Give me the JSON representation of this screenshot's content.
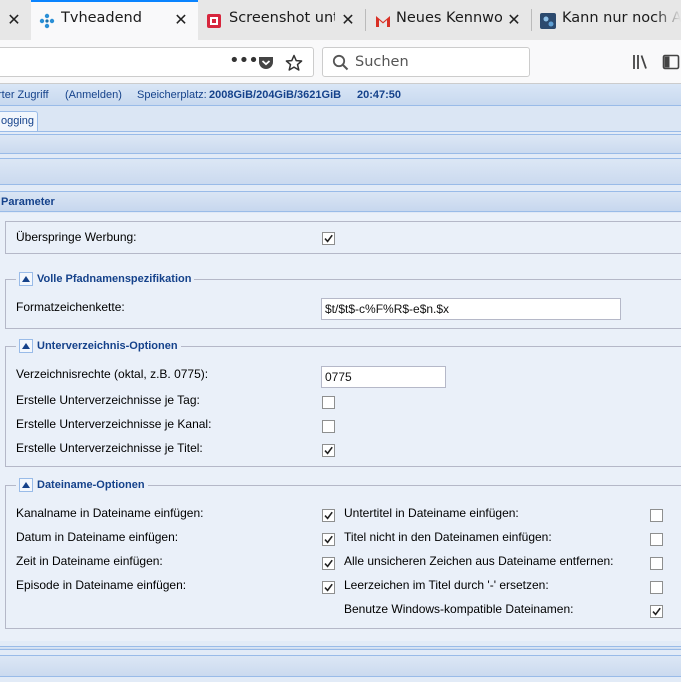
{
  "browser": {
    "tabs": [
      {
        "title": "Tvheadend",
        "favicon": "tvheadend-icon"
      },
      {
        "title": "Screenshot unter",
        "favicon": "screenshot-icon"
      },
      {
        "title": "Neues Kennwort",
        "favicon": "gmail-icon"
      },
      {
        "title": "Kann nur noch Ar",
        "favicon": "forum-icon"
      }
    ],
    "search_placeholder": "Suchen",
    "accent_color": "#0a84ff"
  },
  "status": {
    "access": "rter Zugriff",
    "login": "(Anmelden)",
    "storage_label": "Speicherplatz:",
    "storage_value": "2008GiB/204GiB/3621GiB",
    "time": "20:47:50"
  },
  "subtab": {
    "label": "ogging"
  },
  "panel": {
    "title": "Parameter",
    "skip_commercials": {
      "label": "Überspringe Werbung:",
      "checked": true
    },
    "path_section": {
      "title": "Volle Pfadnamenspezifikation",
      "format_label": "Formatzeichenkette:",
      "format_value": "$t/$t$-c%F%R$-e$n.$x"
    },
    "subdir_section": {
      "title": "Unterverzeichnis-Optionen",
      "rights_label": "Verzeichnisrechte (oktal, z.B. 0775):",
      "rights_value": "0775",
      "per_day": {
        "label": "Erstelle Unterverzeichnisse je Tag:",
        "checked": false
      },
      "per_channel": {
        "label": "Erstelle Unterverzeichnisse je Kanal:",
        "checked": false
      },
      "per_title": {
        "label": "Erstelle Unterverzeichnisse je Titel:",
        "checked": true
      }
    },
    "filename_section": {
      "title": "Dateiname-Optionen",
      "left": [
        {
          "label": "Kanalname in Dateiname einfügen:",
          "checked": true
        },
        {
          "label": "Datum in Dateiname einfügen:",
          "checked": true
        },
        {
          "label": "Zeit in Dateiname einfügen:",
          "checked": true
        },
        {
          "label": "Episode in Dateiname einfügen:",
          "checked": true
        }
      ],
      "right": [
        {
          "label": "Untertitel in Dateiname einfügen:",
          "checked": false
        },
        {
          "label": "Titel nicht in den Dateinamen einfügen:",
          "checked": false
        },
        {
          "label": "Alle unsicheren Zeichen aus Dateiname entfernen:",
          "checked": false
        },
        {
          "label": "Leerzeichen im Titel durch '-' ersetzen:",
          "checked": false
        },
        {
          "label": "Benutze Windows-kompatible Dateinamen:",
          "checked": true
        }
      ]
    }
  }
}
